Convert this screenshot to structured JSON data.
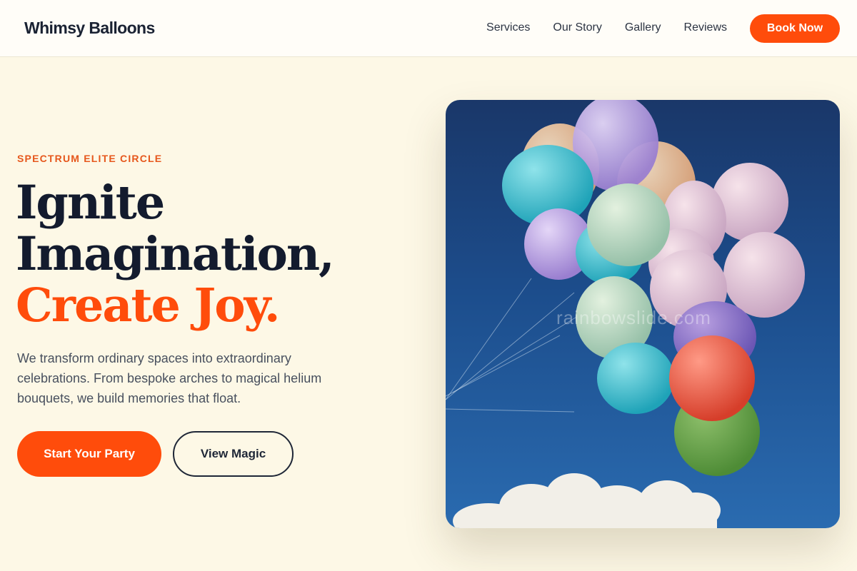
{
  "header": {
    "logo": "Whimsy Balloons",
    "nav": [
      {
        "label": "Services"
      },
      {
        "label": "Our Story"
      },
      {
        "label": "Gallery"
      },
      {
        "label": "Reviews"
      }
    ],
    "cta": "Book Now"
  },
  "hero": {
    "eyebrow": "SPECTRUM ELITE CIRCLE",
    "headline_line1": "Ignite",
    "headline_line2": "Imagination,",
    "headline_accent": "Create Joy.",
    "lead": "We transform ordinary spaces into extraordinary celebrations. From bespoke arches to magical helium bouquets, we build memories that float.",
    "primary_button": "Start Your Party",
    "secondary_button": "View Magic",
    "image_watermark": "rainbowslide.com"
  },
  "colors": {
    "accent": "#ff4c0b",
    "background": "#fdf8e6",
    "text": "#131b2e"
  }
}
